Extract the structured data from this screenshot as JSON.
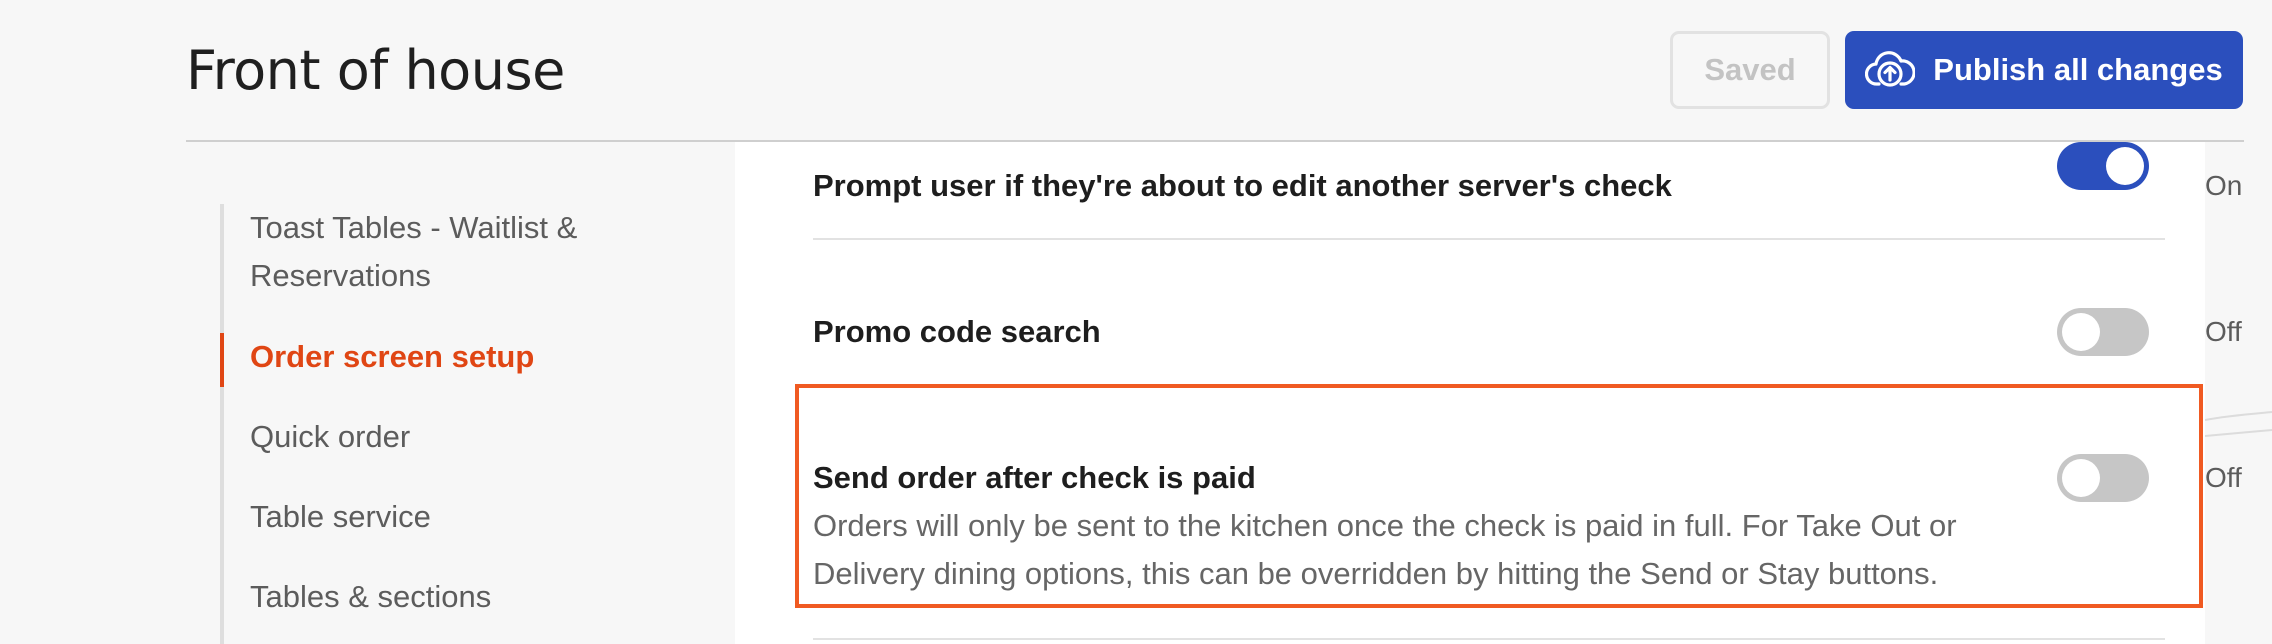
{
  "header": {
    "title": "Front of house",
    "saved_label": "Saved",
    "publish_label": "Publish all changes",
    "publish_icon": "cloud-upload-icon"
  },
  "sidebar": {
    "items": [
      {
        "label": "Toast Tables - Waitlist & Reservations",
        "active": false
      },
      {
        "label": "Order screen setup",
        "active": true
      },
      {
        "label": "Quick order",
        "active": false
      },
      {
        "label": "Table service",
        "active": false
      },
      {
        "label": "Tables & sections",
        "active": false
      }
    ]
  },
  "settings": [
    {
      "label": "Prompt user if they're about to edit another server's check",
      "state": "On",
      "enabled": true
    },
    {
      "label": "Promo code search",
      "state": "Off",
      "enabled": false
    },
    {
      "label": "Send order after check is paid",
      "state": "Off",
      "enabled": false,
      "description": "Orders will only be sent to the kitchen once the check is paid in full. For Take Out or Delivery dining options, this can be overridden by hitting the Send or Stay buttons.",
      "highlighted": true
    }
  ],
  "colors": {
    "accent_blue": "#2b4fbd",
    "active_orange": "#e04614",
    "highlight_orange": "#f05a22",
    "toggle_off": "#c6c6c6"
  }
}
